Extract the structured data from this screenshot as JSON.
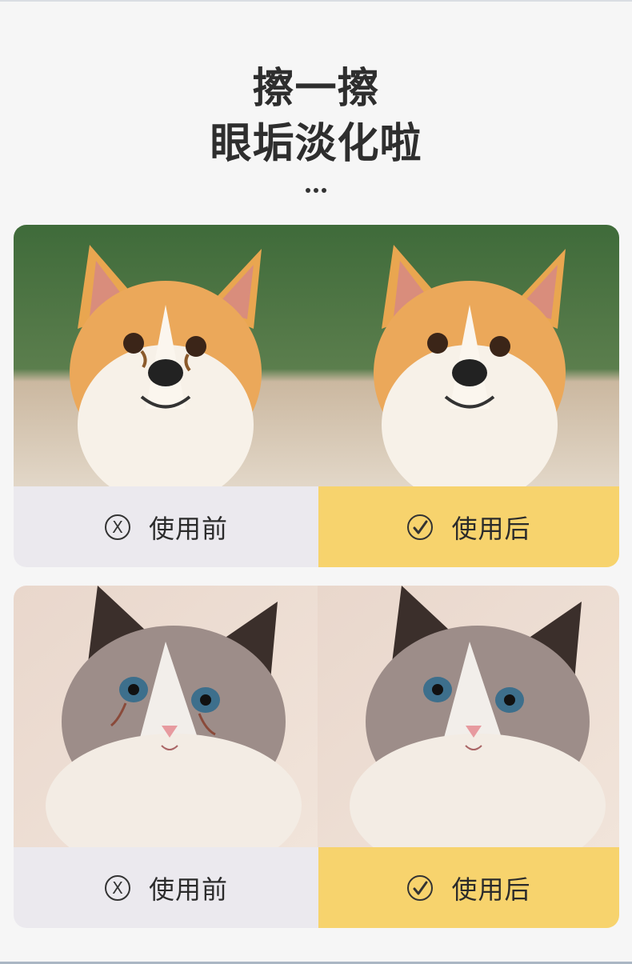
{
  "headline": {
    "line1": "擦一擦",
    "line2": "眼垢淡化啦"
  },
  "comparisons": [
    {
      "subject": "dog",
      "before": {
        "icon": "x-circle-icon",
        "label": "使用前"
      },
      "after": {
        "icon": "check-circle-icon",
        "label": "使用后"
      }
    },
    {
      "subject": "cat",
      "before": {
        "icon": "x-circle-icon",
        "label": "使用前"
      },
      "after": {
        "icon": "check-circle-icon",
        "label": "使用后"
      }
    }
  ],
  "colors": {
    "background": "#f6f6f6",
    "before_bg": "#ebe9ee",
    "after_bg": "#f7d36d",
    "text": "#2b2b2b"
  }
}
